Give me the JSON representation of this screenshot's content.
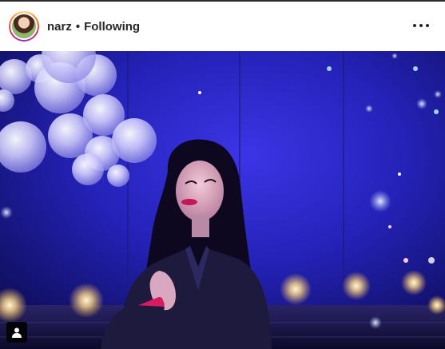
{
  "header": {
    "username": "narz",
    "separator": "•",
    "follow_status": "Following",
    "more_icon": "more-horizontal-icon"
  },
  "photo": {
    "alt": "Woman with dark hair and red lipstick in a leather jacket, standing under blue lights with white balloons and glowing bubbles",
    "tag_icon": "user-tag-icon"
  },
  "colors": {
    "text": "#262626",
    "background": "#ffffff",
    "scene_blue": "#2a2ad8"
  }
}
